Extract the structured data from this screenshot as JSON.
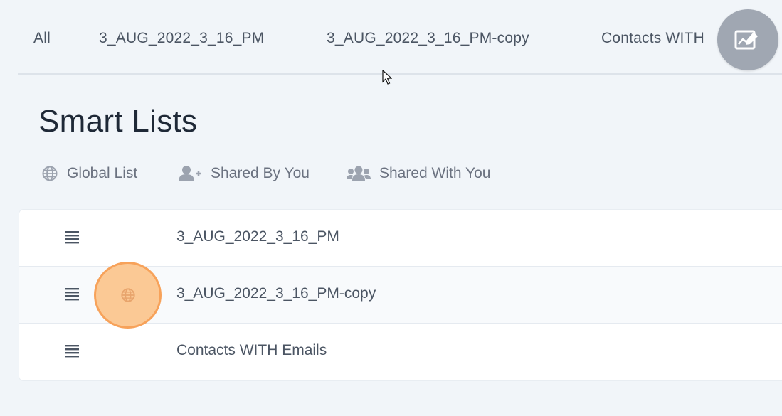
{
  "tabs": [
    {
      "label": "All"
    },
    {
      "label": "3_AUG_2022_3_16_PM"
    },
    {
      "label": "3_AUG_2022_3_16_PM-copy"
    },
    {
      "label": "Contacts WITH"
    }
  ],
  "page": {
    "title": "Smart Lists"
  },
  "filters": [
    {
      "label": "Global List",
      "icon": "globe-icon"
    },
    {
      "label": "Shared By You",
      "icon": "user-plus-icon"
    },
    {
      "label": "Shared With You",
      "icon": "users-icon"
    }
  ],
  "lists": [
    {
      "name": "3_AUG_2022_3_16_PM",
      "global": false
    },
    {
      "name": "3_AUG_2022_3_16_PM-copy",
      "global": true
    },
    {
      "name": "Contacts WITH Emails",
      "global": false
    }
  ],
  "colors": {
    "background": "#f1f5f9",
    "card": "#ffffff",
    "text": "#4b5563",
    "title": "#1f2937",
    "fab": "#9ca3af",
    "highlight_fill": "#fbc995",
    "highlight_ring": "#f7a25a"
  },
  "fab": {
    "icon": "chart-edit-icon"
  }
}
